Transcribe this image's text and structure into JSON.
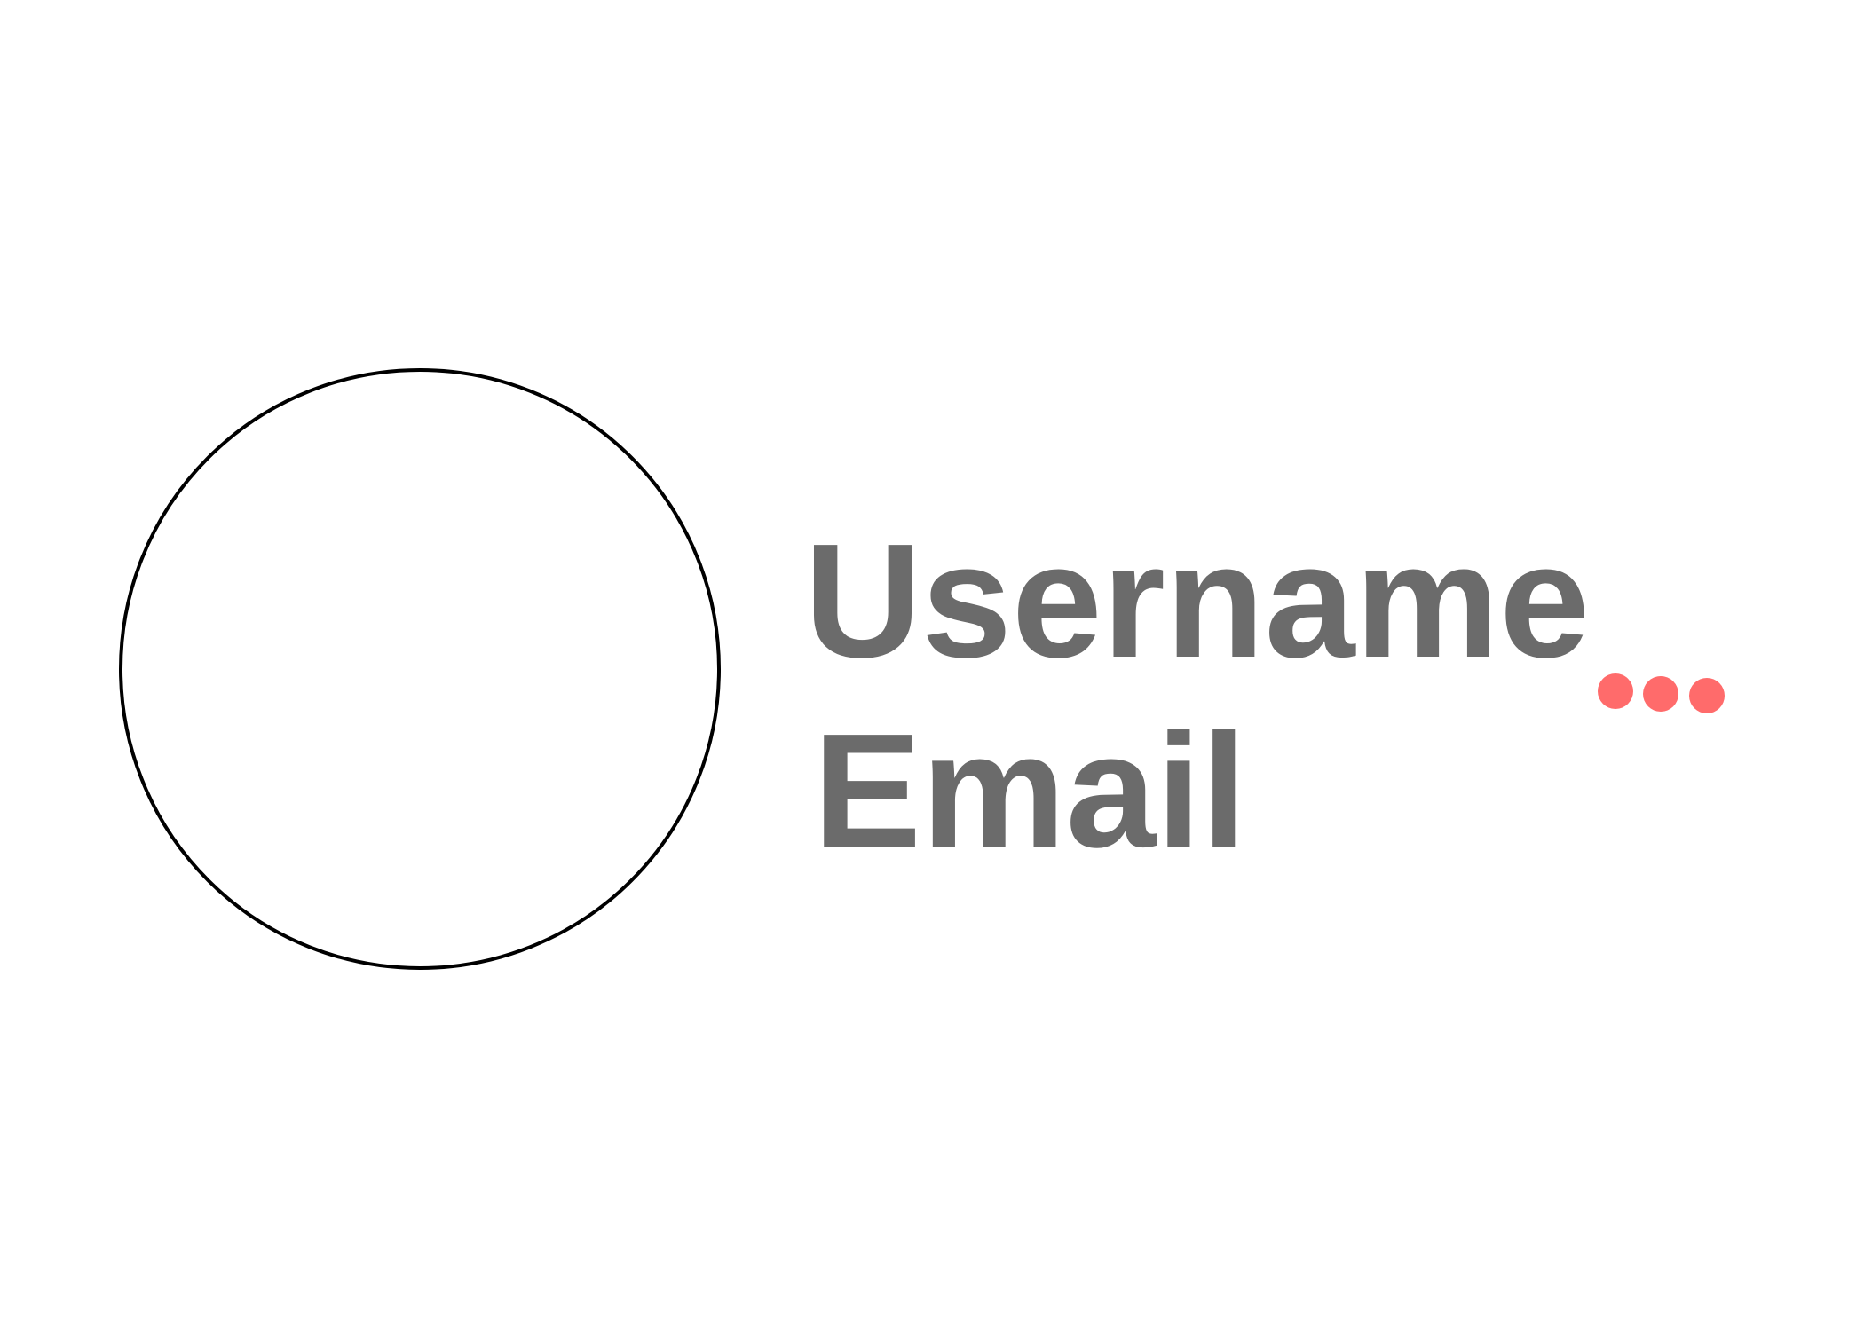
{
  "profile": {
    "username": "Username",
    "email": "Email"
  },
  "colors": {
    "accent": "#ff6b6b",
    "text": "#6b6b6b"
  },
  "icons": {
    "more": "more-dots-icon",
    "avatar": "avatar-placeholder"
  }
}
